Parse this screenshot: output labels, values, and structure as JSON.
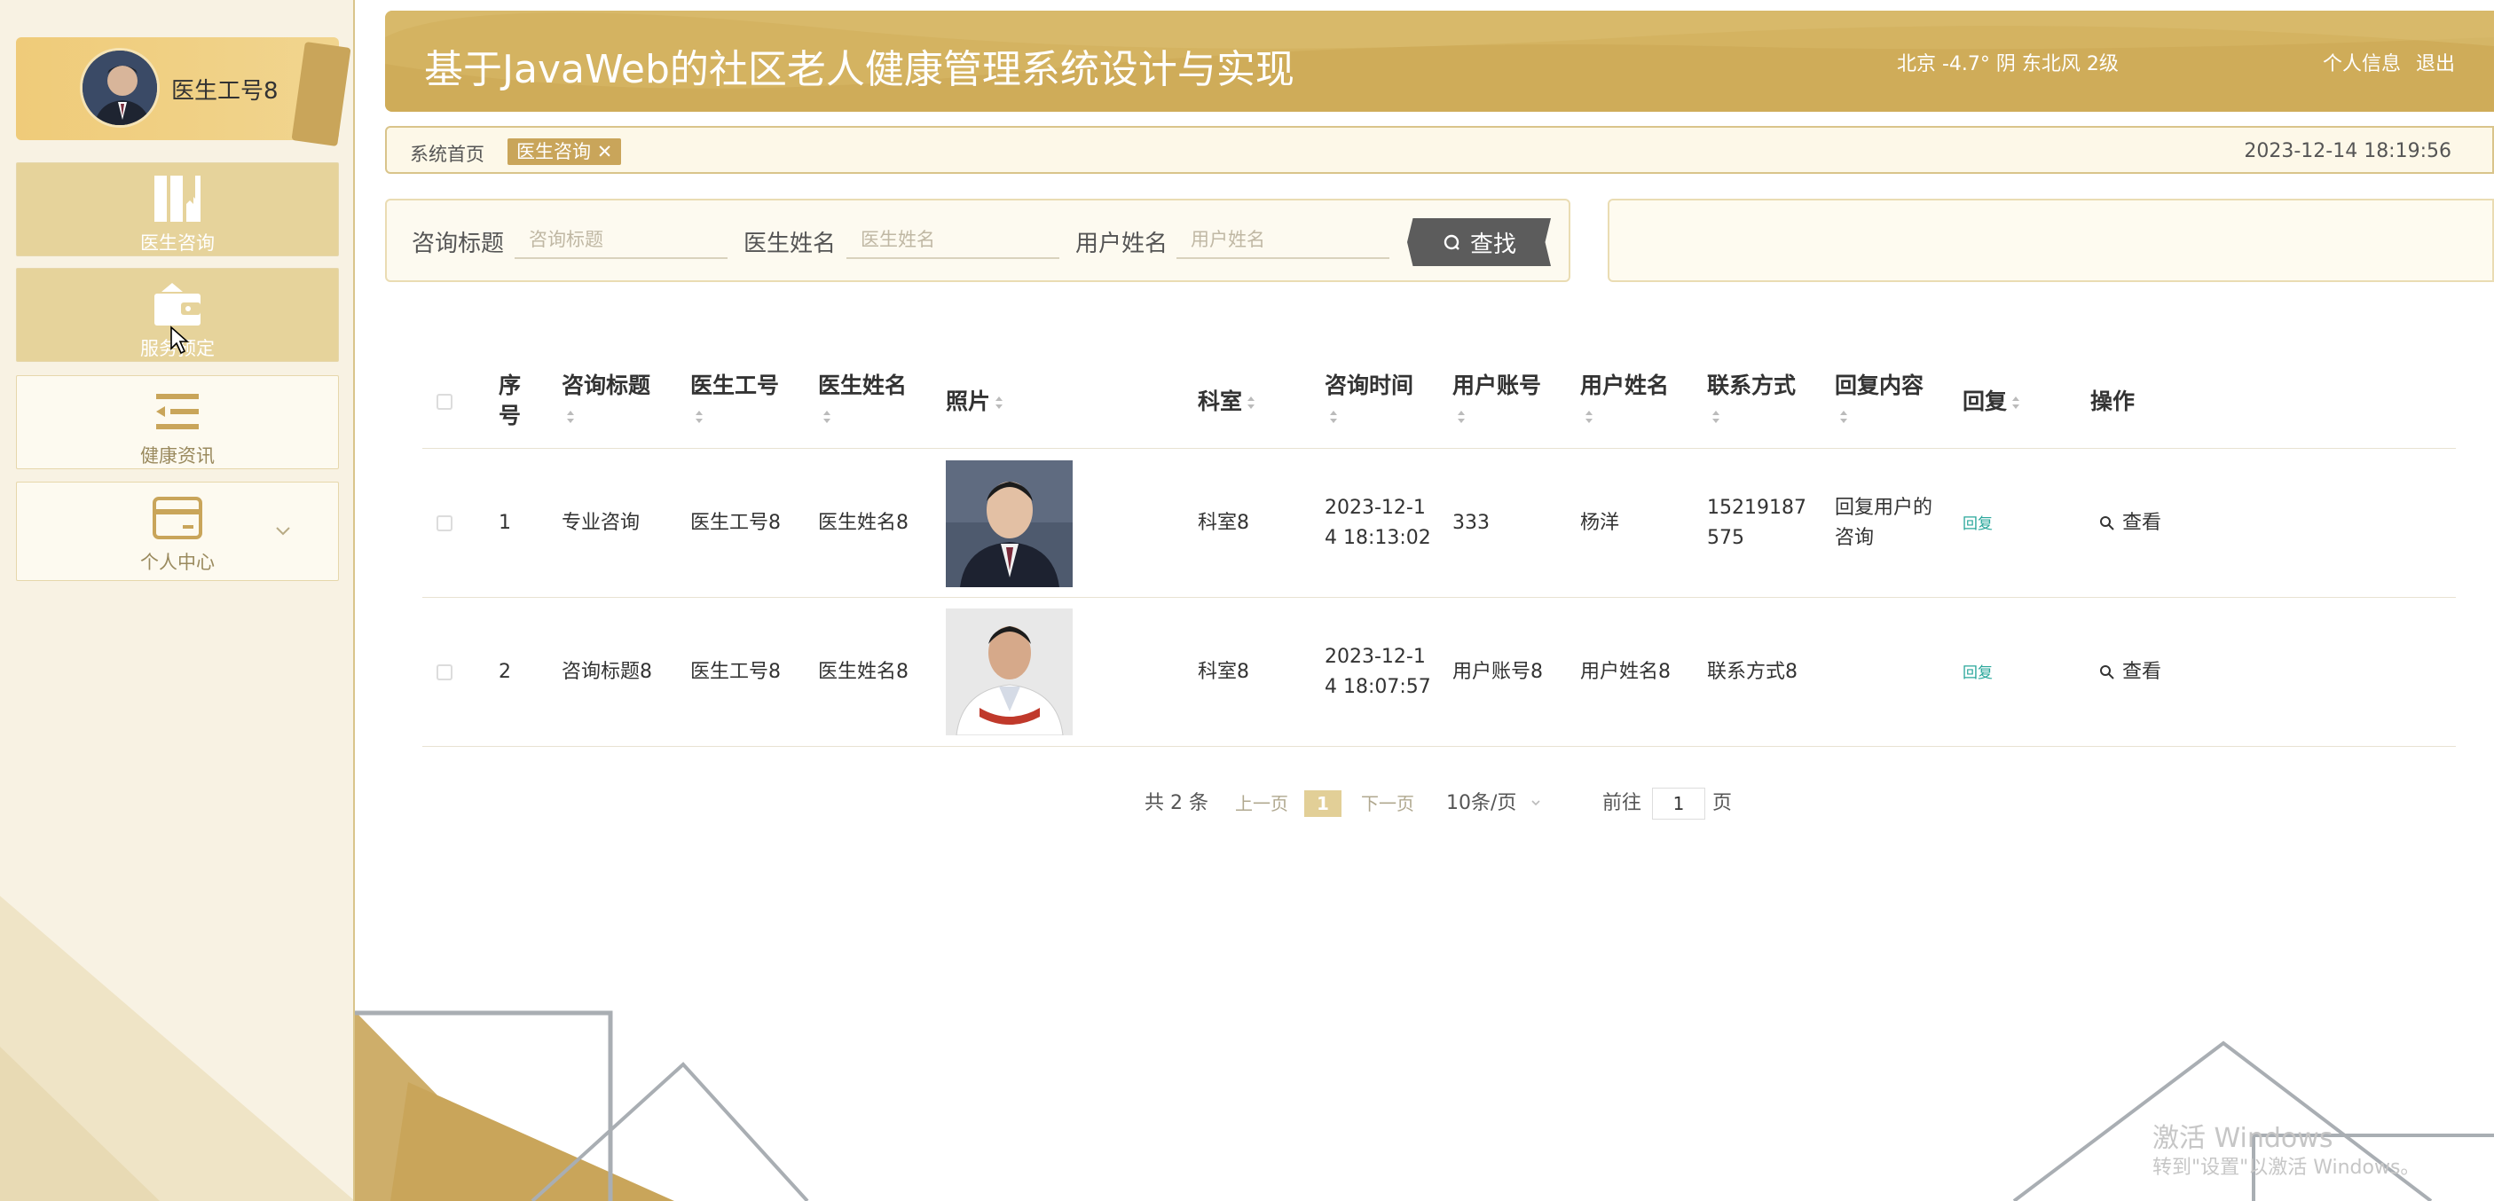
{
  "header": {
    "title": "基于JavaWeb的社区老人健康管理系统设计与实现",
    "weather": "北京  -4.7°  阴  东北风  2级",
    "links": [
      "个人信息",
      "退出"
    ]
  },
  "sidebar": {
    "user_name": "医生工号8",
    "items": [
      {
        "label": "医生咨询",
        "icon": "bookmark-icon",
        "active": true
      },
      {
        "label": "服务预定",
        "icon": "wallet-icon",
        "active": true
      },
      {
        "label": "健康资讯",
        "icon": "list-indent-icon",
        "active": false
      },
      {
        "label": "个人中心",
        "icon": "card-icon",
        "active": false
      }
    ]
  },
  "breadcrumb": {
    "home": "系统首页",
    "tag": "医生咨询",
    "datetime": "2023-12-14 18:19:56"
  },
  "search": {
    "fields": [
      {
        "label": "咨询标题",
        "placeholder": "咨询标题",
        "value": ""
      },
      {
        "label": "医生姓名",
        "placeholder": "医生姓名",
        "value": ""
      },
      {
        "label": "用户姓名",
        "placeholder": "用户姓名",
        "value": ""
      }
    ],
    "button": "查找"
  },
  "table": {
    "headers": {
      "index": "序\n号",
      "title": "咨询标题",
      "doctor_no": "医生工号",
      "doctor_name": "医生姓名",
      "photo": "照片",
      "dept": "科室",
      "time": "咨询时间",
      "user_account": "用户账号",
      "user_name": "用户姓名",
      "contact": "联系方式",
      "reply_content": "回复内容",
      "reply": "回复",
      "ops": "操作"
    },
    "rows": [
      {
        "index": "1",
        "title": "专业咨询",
        "doctor_no": "医生工号8",
        "doctor_name": "医生姓名8",
        "dept": "科室8",
        "time": "2023-12-1\n4 18:13:02",
        "user_account": "333",
        "user_name": "杨洋",
        "contact": "15219187\n575",
        "reply_content": "回复用户的\n咨询",
        "reply": "回复",
        "op": "查看"
      },
      {
        "index": "2",
        "title": "咨询标题8",
        "doctor_no": "医生工号8",
        "doctor_name": "医生姓名8",
        "dept": "科室8",
        "time": "2023-12-1\n4 18:07:57",
        "user_account": "用户账号8",
        "user_name": "用户姓名8",
        "contact": "联系方式8",
        "reply_content": "",
        "reply": "回复",
        "op": "查看"
      }
    ]
  },
  "pagination": {
    "total": "共 2 条",
    "prev": "上一页",
    "current": "1",
    "next": "下一页",
    "page_size": "10条/页",
    "goto_prefix": "前往",
    "goto_value": "1",
    "goto_suffix": "页"
  },
  "watermark": {
    "line1": "激活 Windows",
    "line2": "转到\"设置\"以激活 Windows。"
  },
  "colors": {
    "gold": "#d4b361",
    "gold_light": "#efcb79",
    "reply_green": "#2aa79b",
    "search_button": "#5c5c5c"
  }
}
